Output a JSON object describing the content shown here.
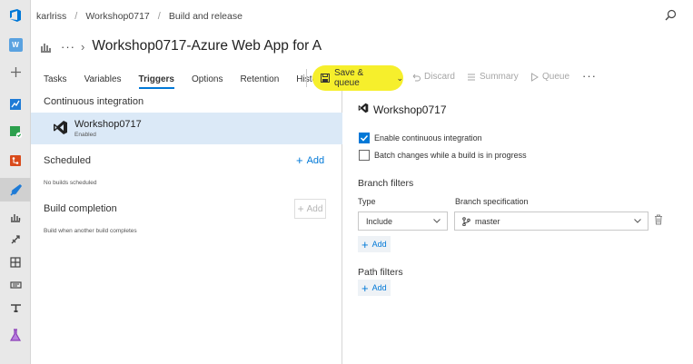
{
  "breadcrumb": {
    "org": "karlriss",
    "project": "Workshop0717",
    "area": "Build and release"
  },
  "rail": {
    "workspace_initial": "W"
  },
  "title": {
    "text": "Workshop0717-Azure Web App for A"
  },
  "tabs": [
    {
      "label": "Tasks"
    },
    {
      "label": "Variables"
    },
    {
      "label": "Triggers",
      "active": true
    },
    {
      "label": "Options"
    },
    {
      "label": "Retention"
    },
    {
      "label": "History"
    }
  ],
  "toolbar": {
    "save_label": "Save & queue",
    "discard_label": "Discard",
    "summary_label": "Summary",
    "queue_label": "Queue"
  },
  "left": {
    "ci_title": "Continuous integration",
    "ci_item_name": "Workshop0717",
    "ci_item_status": "Enabled",
    "scheduled_title": "Scheduled",
    "scheduled_add": "Add",
    "scheduled_note": "No builds scheduled",
    "completion_title": "Build completion",
    "completion_add": "Add",
    "completion_note": "Build when another build completes"
  },
  "right": {
    "title": "Workshop0717",
    "enable_ci_label": "Enable continuous integration",
    "enable_ci_checked": true,
    "batch_label": "Batch changes while a build is in progress",
    "batch_checked": false,
    "branch_filters_title": "Branch filters",
    "type_label": "Type",
    "branch_spec_label": "Branch specification",
    "type_value": "Include",
    "branch_value": "master",
    "branch_add": "Add",
    "path_filters_title": "Path filters",
    "path_add": "Add"
  },
  "colors": {
    "accent": "#0078d7",
    "highlight": "#f6ef2c",
    "selected_row": "#dbe9f7"
  }
}
